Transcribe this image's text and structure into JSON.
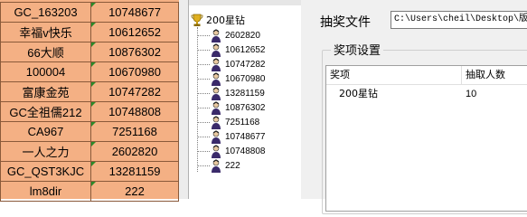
{
  "sheet": {
    "rows": [
      {
        "name": "GC_163203",
        "value": "10748677"
      },
      {
        "name": "幸福v快乐",
        "value": "10612652"
      },
      {
        "name": "66大顺",
        "value": "10876302"
      },
      {
        "name": "100004",
        "value": "10670980"
      },
      {
        "name": "富康金苑",
        "value": "10747282"
      },
      {
        "name": "GC全祖儒212",
        "value": "10748808"
      },
      {
        "name": "CA967",
        "value": "7251168"
      },
      {
        "name": "一人之力",
        "value": "2602820"
      },
      {
        "name": "GC_QST3KJC",
        "value": "13281159"
      },
      {
        "name": "lm8dir",
        "value": "222"
      }
    ]
  },
  "tree": {
    "root_label": "200星钻",
    "root_icon": "trophy-icon",
    "child_icon": "person-icon",
    "children": [
      "2602820",
      "10612652",
      "10747282",
      "10670980",
      "13281159",
      "10876302",
      "7251168",
      "10748677",
      "10748808",
      "222"
    ]
  },
  "panel": {
    "file_label": "抽奖文件",
    "file_path": "C:\\Users\\cheil\\Desktop\\版",
    "group_title": "奖项设置",
    "columns": [
      "奖项",
      "抽取人数"
    ],
    "rows": [
      {
        "prize": "200星钻",
        "count": "10"
      }
    ]
  }
}
